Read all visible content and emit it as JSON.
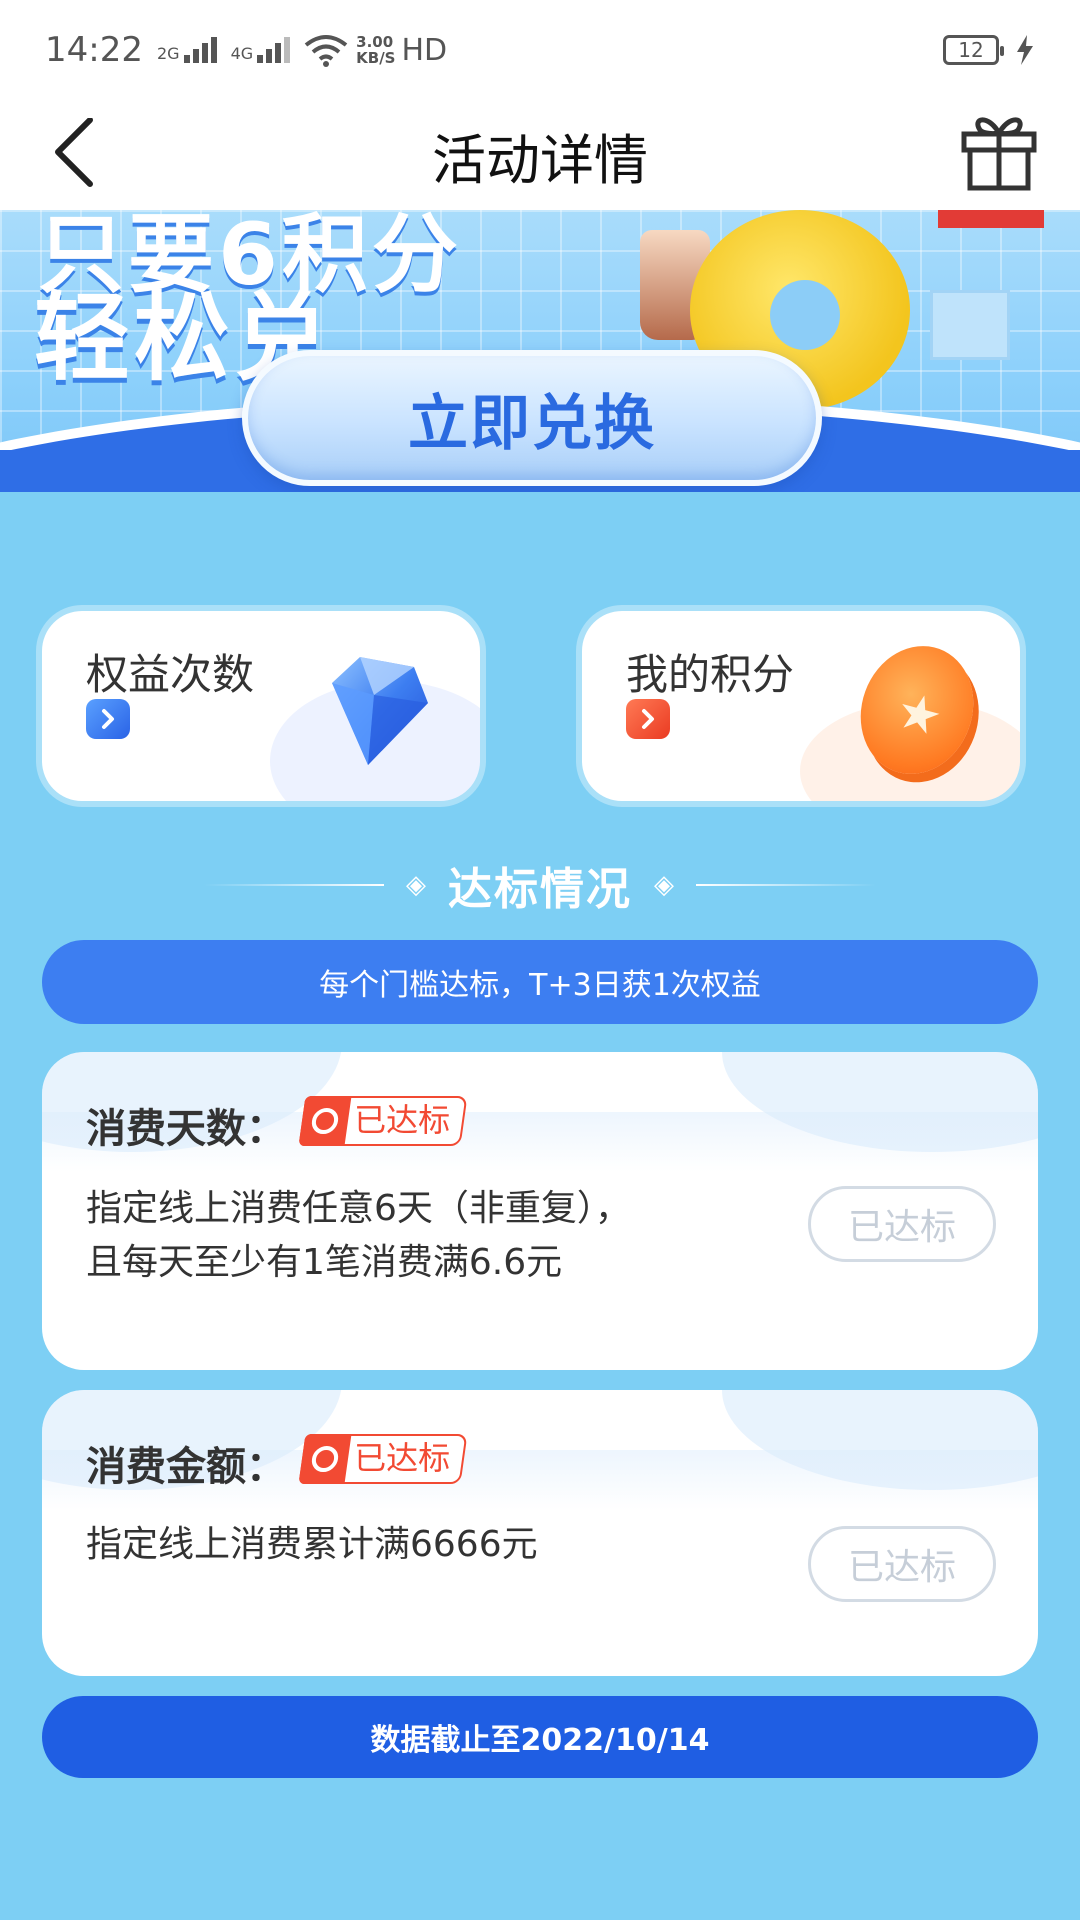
{
  "status_bar": {
    "time": "14:22",
    "network1": "2G",
    "network2": "4G",
    "speed": "3.00",
    "speed_unit": "KB/S",
    "hd": "HD",
    "battery": "12"
  },
  "nav": {
    "title": "活动详情"
  },
  "banner": {
    "slogan_top": "只要6积分",
    "slogan": "轻松兑",
    "exchange_button": "立即兑换"
  },
  "cards": {
    "quanyi_label": "权益次数",
    "jifen_label": "我的积分"
  },
  "section": {
    "title": "达标情况",
    "rule": "每个门槛达标，T+3日获1次权益"
  },
  "requirements": [
    {
      "title": "消费天数：",
      "badge": "已达标",
      "desc_line1": "指定线上消费任意6天（非重复），",
      "desc_line2": "且每天至少有1笔消费满6.6元",
      "status": "已达标"
    },
    {
      "title": "消费金额：",
      "badge": "已达标",
      "desc_line1": "指定线上消费累计满6666元",
      "status": "已达标"
    }
  ],
  "footer": {
    "data_date": "数据截止至2022/10/14"
  },
  "colors": {
    "page_bg": "#7dcff4",
    "primary_blue": "#3d7ef1",
    "dark_blue": "#1f5ee3",
    "badge_red": "#f24a33"
  }
}
